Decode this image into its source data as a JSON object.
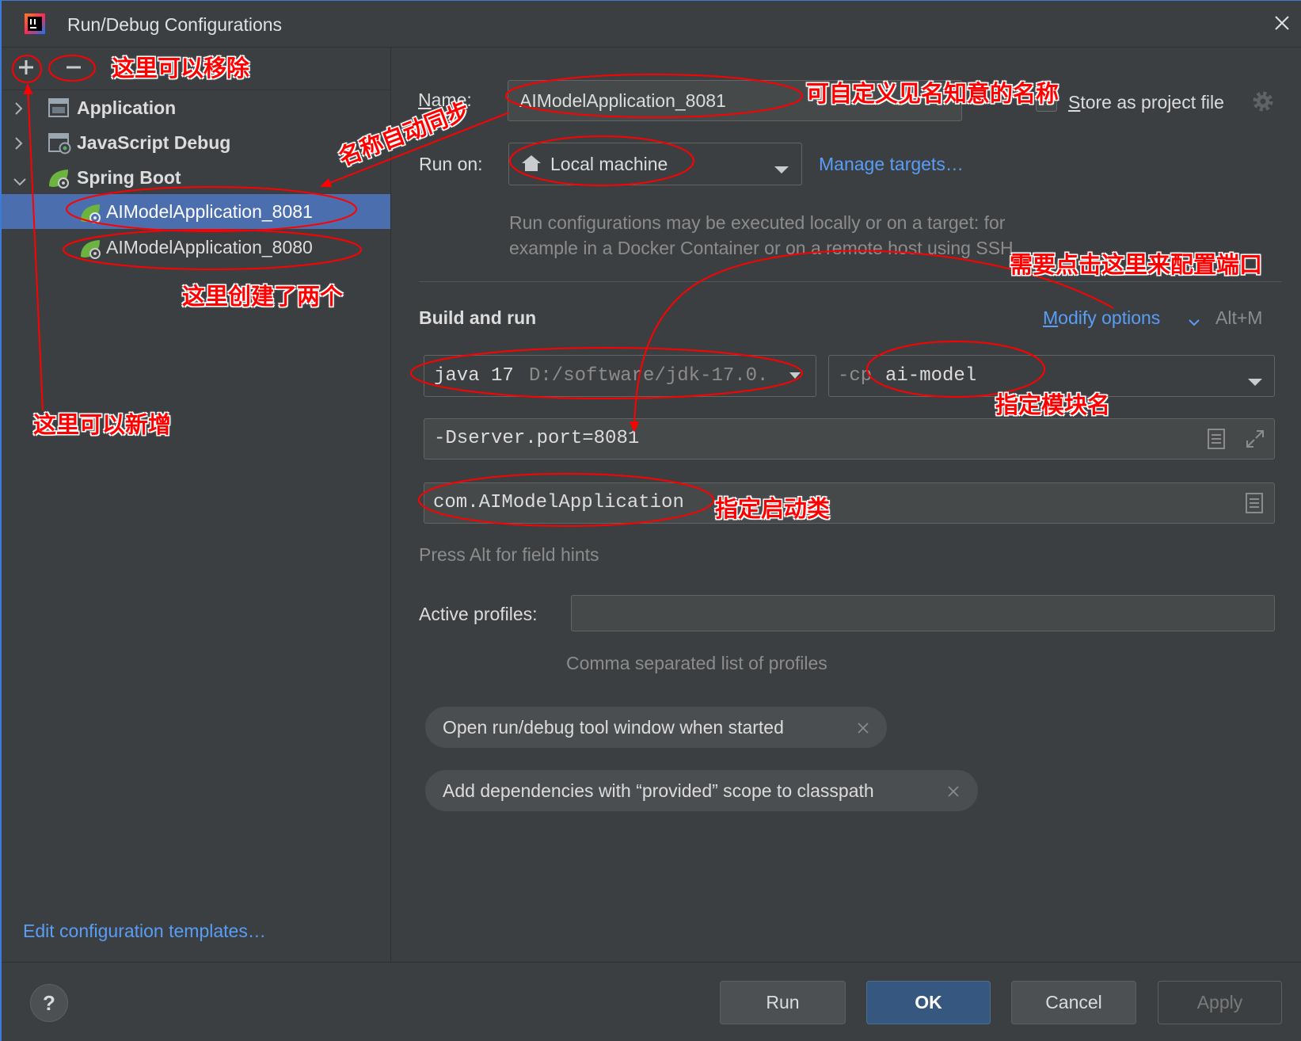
{
  "window": {
    "title": "Run/Debug Configurations",
    "app_icon": "intellij-idea-icon",
    "close_icon": "close-icon"
  },
  "toolbar": {
    "add_icon": "add-icon",
    "remove_icon": "remove-icon"
  },
  "tree": {
    "items": [
      {
        "label": "Application",
        "icon": "application-icon",
        "expanded": false
      },
      {
        "label": "JavaScript Debug",
        "icon": "javascript-debug-icon",
        "expanded": false
      },
      {
        "label": "Spring Boot",
        "icon": "spring-boot-icon",
        "expanded": true,
        "children": [
          {
            "label": "AIModelApplication_8081",
            "icon": "spring-boot-config-icon",
            "selected": true
          },
          {
            "label": "AIModelApplication_8080",
            "icon": "spring-boot-config-icon",
            "selected": false
          }
        ]
      }
    ]
  },
  "left_footer": {
    "edit_templates_link": "Edit configuration templates…"
  },
  "form": {
    "name": {
      "label": "Name:",
      "value": "AIModelApplication_8081"
    },
    "store_as_project_file": {
      "label": "Store as project file",
      "checked": false,
      "icon": "gear-icon"
    },
    "run_on": {
      "label": "Run on:",
      "value": "Local machine",
      "icon": "home-icon",
      "manage_targets": "Manage targets…",
      "description": [
        "Run configurations may be executed locally or on a target: for",
        "example in a Docker Container or on a remote host using SSH"
      ]
    },
    "build_and_run": {
      "heading": "Build and run",
      "modify_options": "Modify options",
      "modify_options_shortcut": "Alt+M",
      "jre_version": "java 17",
      "jre_path": "D:/software/jdk-17.0.",
      "classpath_prefix": "-cp",
      "module": "ai-model",
      "vm_options": "-Dserver.port=8081",
      "main_class": "com.AIModelApplication",
      "hint": "Press Alt for field hints"
    },
    "active_profiles": {
      "label": "Active profiles:",
      "value": "",
      "hint": "Comma separated list of profiles"
    },
    "option_chips": [
      {
        "label": "Open run/debug tool window when started"
      },
      {
        "label": "Add dependencies with “provided” scope to classpath"
      }
    ]
  },
  "buttons": {
    "help": "?",
    "run": {
      "label": "Run",
      "enabled": true
    },
    "ok": {
      "label": "OK",
      "enabled": true,
      "default": true
    },
    "cancel": {
      "label": "Cancel",
      "enabled": true
    },
    "apply": {
      "label": "Apply",
      "enabled": false
    }
  },
  "annotations": {
    "remove_hint": "这里可以移除",
    "name_sync": "名称自动同步",
    "created_two": "这里创建了两个",
    "add_hint": "这里可以新增",
    "custom_name": "可自定义见名知意的名称",
    "configure_port": "需要点击这里来配置端口",
    "module_name": "指定模块名",
    "main_class": "指定启动类"
  },
  "colors": {
    "background": "#3c3f41",
    "selection": "#4b6eaf",
    "link": "#589df6",
    "primary_button": "#365880",
    "spring_green": "#6db33f",
    "annotation": "#ff0000"
  }
}
